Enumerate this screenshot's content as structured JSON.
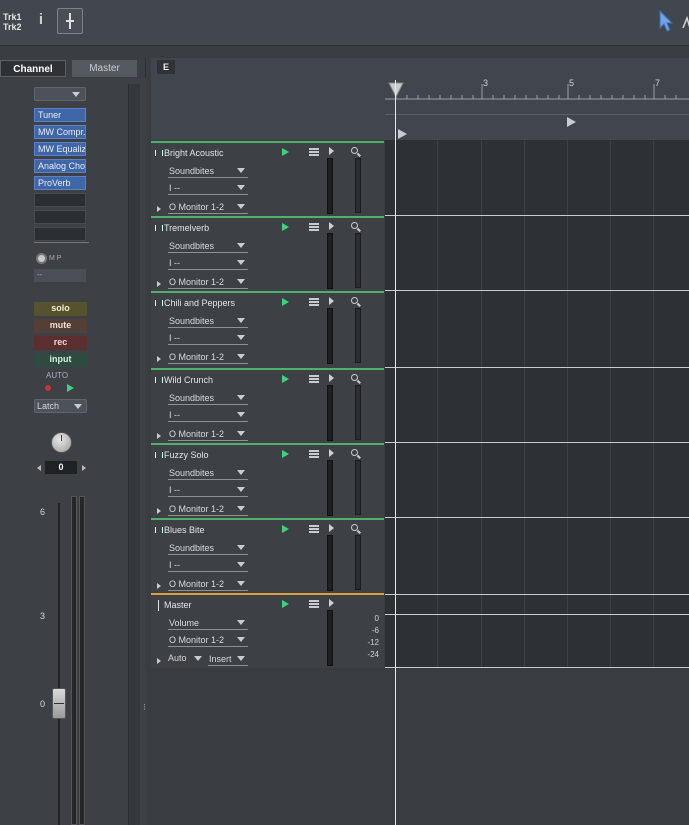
{
  "toolbar": {
    "track_line1": "Trk1",
    "track_line2": "Trk2",
    "info_label": "i"
  },
  "left_panel": {
    "tabs": [
      "Channel Strip",
      "Master"
    ],
    "input_dropdown": "",
    "inserts": [
      "Tuner",
      "MW Compr...",
      "MW Equalizer",
      "Analog Cho...",
      "ProVerb"
    ],
    "send_mp": "M P",
    "send_value": "--",
    "solo": "solo",
    "mute": "mute",
    "rec": "rec",
    "input": "input",
    "auto_label": "AUTO",
    "automation_mode": "Latch",
    "pan_value": "0",
    "fader_scale": [
      "6",
      "3",
      "0"
    ]
  },
  "arrange": {
    "e_button": "E",
    "ruler_marks": [
      "3",
      "5",
      "7"
    ]
  },
  "tracks": [
    {
      "name": "Bright Acoustic",
      "instrument": "Soundbites",
      "input": "I --",
      "output": "O Monitor 1-2"
    },
    {
      "name": "Tremelverb",
      "instrument": "Soundbites",
      "input": "I --",
      "output": "O Monitor 1-2"
    },
    {
      "name": "Chili and Peppers",
      "instrument": "Soundbites",
      "input": "I --",
      "output": "O Monitor 1-2"
    },
    {
      "name": "Wild Crunch",
      "instrument": "Soundbites",
      "input": "I --",
      "output": "O Monitor 1-2"
    },
    {
      "name": "Fuzzy Solo",
      "instrument": "Soundbites",
      "input": "I --",
      "output": "O Monitor 1-2"
    },
    {
      "name": "Blues Bite",
      "instrument": "Soundbites",
      "input": "I --",
      "output": "O Monitor 1-2"
    }
  ],
  "master": {
    "name": "Master",
    "param": "Volume",
    "output": "O Monitor 1-2",
    "auto": "Auto",
    "insert": "Insert",
    "scale": [
      "0",
      "-6",
      "-12",
      "-24"
    ]
  },
  "colors": {
    "track_accent": "#4fb26a",
    "master_accent": "#d9a13a",
    "insert_blue": "#3f67a8"
  }
}
